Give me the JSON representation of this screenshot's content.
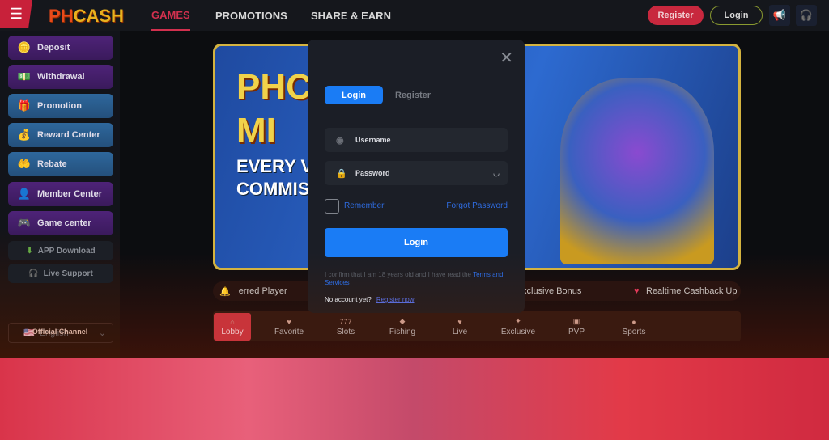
{
  "header": {
    "logo": "PHCASH",
    "logo_a": "PH",
    "logo_b": "CASH",
    "nav": [
      {
        "label": "GAMES",
        "active": true
      },
      {
        "label": "PROMOTIONS"
      },
      {
        "label": "SHARE & EARN"
      }
    ],
    "register": "Register",
    "login": "Login"
  },
  "sidebar": {
    "items": [
      {
        "label": "Deposit",
        "icon": "wallet-icon"
      },
      {
        "label": "Withdrawal",
        "icon": "money-icon"
      },
      {
        "label": "Promotion",
        "icon": "gift-icon"
      },
      {
        "label": "Reward Center",
        "icon": "coins-icon"
      },
      {
        "label": "Rebate",
        "icon": "rebate-icon"
      },
      {
        "label": "Member Center",
        "icon": "user-icon"
      },
      {
        "label": "Game center",
        "icon": "gamepad-icon"
      }
    ],
    "app_download": "APP Download",
    "live_support": "Live Support",
    "language": "English",
    "official_channel": "Official Channel"
  },
  "marquee": {
    "segments": [
      "erred Player",
      "xclusive Bonus",
      "Realtime Cashback Up"
    ]
  },
  "game_tabs": [
    {
      "label": "Lobby",
      "active": true
    },
    {
      "label": "Favorite"
    },
    {
      "label": "Slots"
    },
    {
      "label": "Fishing"
    },
    {
      "label": "Live"
    },
    {
      "label": "Exclusive"
    },
    {
      "label": "PVP"
    },
    {
      "label": "Sports"
    }
  ],
  "modal": {
    "tab_login": "Login",
    "tab_register": "Register",
    "username_placeholder": "Username",
    "password_placeholder": "Password",
    "remember": "Remember",
    "forgot": "Forgot Password",
    "login_button": "Login",
    "confirm_text": "I confirm that I am 18 years old and I have read the ",
    "terms": "Terms and Services",
    "no_account": "No account yet?",
    "register_now": "Register now"
  },
  "colors": {
    "accent": "#1a7cf5",
    "brand_red": "#c8213a",
    "brand_gold": "#e8b21e"
  }
}
